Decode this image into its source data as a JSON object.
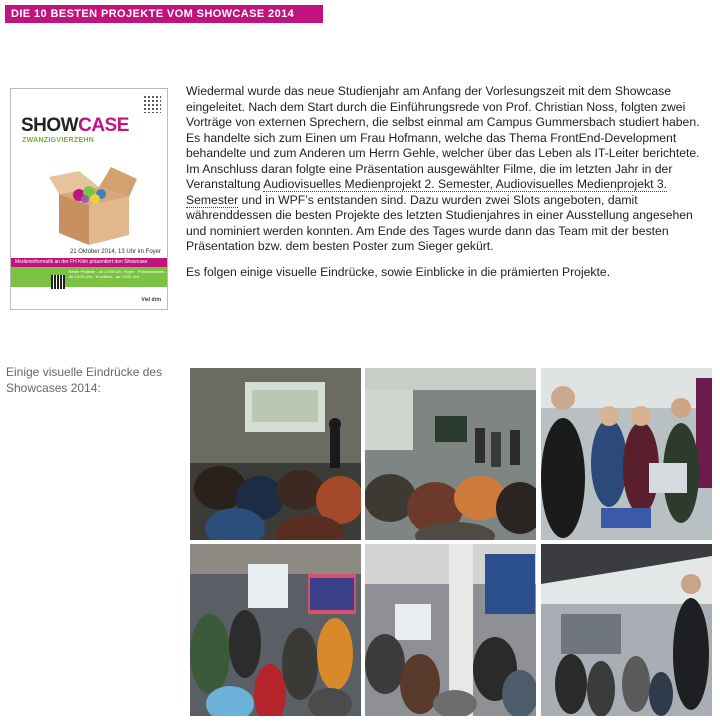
{
  "banner": {
    "title": "DIE 10 BESTEN PROJEKTE VOM SHOWCASE 2014"
  },
  "poster": {
    "title_a": "SHOW",
    "title_b": "CASE",
    "subtitle": "ZWANZIGVIERZEHN",
    "date_line": "21 Oktober 2014, 13 Uhr im Foyer",
    "bar_text": "Medieninformatik an der FH Köln präsentiert den Showcase",
    "schedule": "Beste Projekte - ab 13:00 Uhr, Foyer · Präsentationen - ab 13:30 Uhr · Kurzfilme - ab 14:00 Uhr",
    "logo": "Viel drin"
  },
  "intro": {
    "p1_a": "Wiedermal wurde das neue Studienjahr am Anfang der Vorlesungszeit mit dem Showcase eingeleitet. Nach dem Start durch die Einführungsrede von Prof. Christian Noss, folgten zwei Vorträge von externen Sprechern, die selbst einmal am Campus Gummersbach studiert haben. Es handelte sich zum Einen um Frau Hofmann, welche das Thema FrontEnd-Development behandelte und zum Anderen um Herrn Gehle, welcher über das Leben als IT-Leiter berichtete. Im Anschluss daran folgte eine Präsentation ausgewählter Filme, die im letzten Jahr in der Veranstaltung ",
    "p1_link": "Audiovisuelles Medienprojekt 2. Semester, Audiovisuelles Medienprojekt 3. Semester",
    "p1_b": " und in WPF’s entstanden sind. Dazu wurden zwei Slots angeboten, damit währenddessen die besten Projekte des letzten Studienjahres in einer Ausstellung angesehen und nominiert werden konnten. Am Ende des Tages wurde dann das Team mit der besten Präsentation bzw. dem besten Poster zum Sieger gekürt.",
    "p2": "Es folgen einige visuelle Eindrücke, sowie Einblicke in die prämierten Projekte."
  },
  "gallery": {
    "label": "Einige visuelle Eindrücke des Showcases 2014:"
  }
}
